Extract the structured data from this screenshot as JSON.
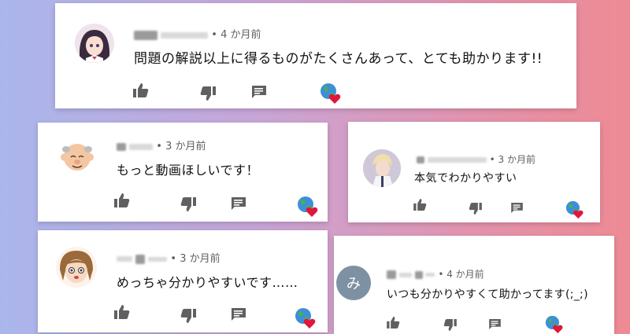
{
  "comments": [
    {
      "time": "4 か月前",
      "text": "問題の解説以上に得るものがたくさんあって、とても助かります!!"
    },
    {
      "time": "3 か月前",
      "text": "もっと動画ほしいです！"
    },
    {
      "time": "3 か月前",
      "text": "本気でわかりやすい"
    },
    {
      "time": "3 か月前",
      "text": "めっちゃ分かりやすいです……"
    },
    {
      "time": "4 か月前",
      "text": "いつも分かりやすくて助かってます(;_;)",
      "avatar_letter": "み"
    }
  ],
  "colors": {
    "heart": "#e0163b",
    "avatar_mi": "#7d91a3",
    "icon": "#606060"
  }
}
